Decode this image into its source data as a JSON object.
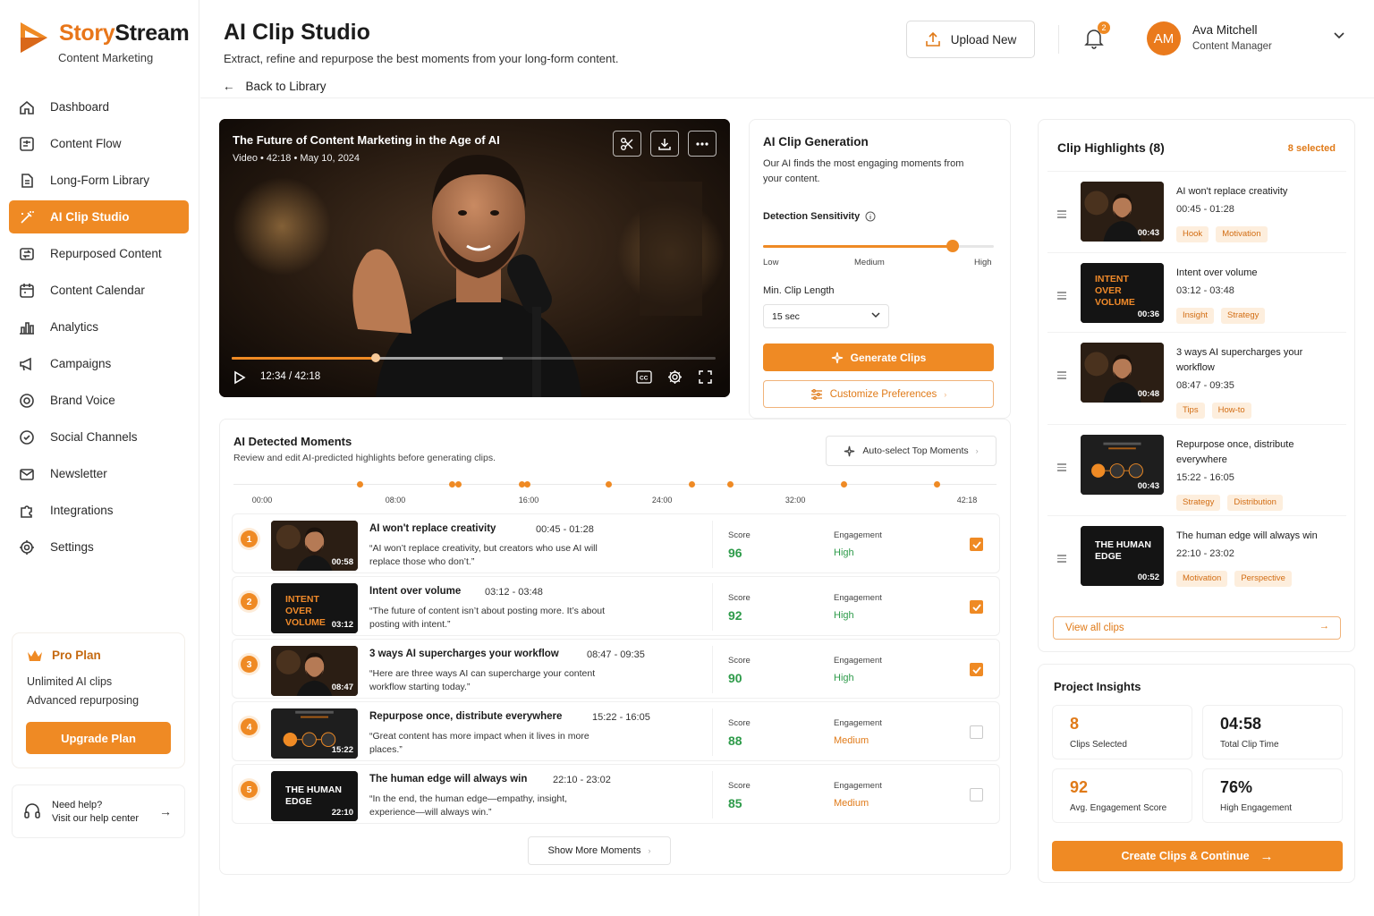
{
  "brand": {
    "name_part1": "Story",
    "name_part2": "Stream",
    "tagline": "Content Marketing"
  },
  "nav": [
    {
      "label": "Dashboard",
      "icon": "home-icon"
    },
    {
      "label": "Content Flow",
      "icon": "flow-icon"
    },
    {
      "label": "Long-Form Library",
      "icon": "document-icon"
    },
    {
      "label": "AI Clip Studio",
      "icon": "wand-icon",
      "active": true
    },
    {
      "label": "Repurposed Content",
      "icon": "repurpose-icon"
    },
    {
      "label": "Content Calendar",
      "icon": "calendar-icon"
    },
    {
      "label": "Analytics",
      "icon": "bar-chart-icon"
    },
    {
      "label": "Campaigns",
      "icon": "megaphone-icon"
    },
    {
      "label": "Brand Voice",
      "icon": "brand-icon"
    },
    {
      "label": "Social Channels",
      "icon": "share-icon"
    },
    {
      "label": "Newsletter",
      "icon": "mail-icon"
    },
    {
      "label": "Integrations",
      "icon": "puzzle-icon"
    },
    {
      "label": "Settings",
      "icon": "gear-icon"
    }
  ],
  "plan": {
    "title": "Pro Plan",
    "feature1": "Unlimited AI clips",
    "feature2": "Advanced repurposing",
    "button": "Upgrade Plan"
  },
  "help": {
    "line1": "Need help?",
    "line2": "Visit our help center"
  },
  "header": {
    "title": "AI Clip Studio",
    "subtitle": "Extract, refine and repurpose the best moments from your long-form content.",
    "back": "Back to Library",
    "upload": "Upload New",
    "notifications": "2",
    "user": {
      "initials": "AM",
      "name": "Ava Mitchell",
      "role": "Content Manager"
    }
  },
  "video": {
    "title": "The Future of Content Marketing in the Age of AI",
    "meta": "Video  •  42:18  •  May 10, 2024",
    "time": "12:34 / 42:18",
    "progress": 0.297,
    "buffered": 0.56
  },
  "generation": {
    "title": "AI Clip Generation",
    "desc": "Our AI finds the most engaging moments from your content.",
    "sensitivity_label": "Detection Sensitivity",
    "sensitivity_value": 0.82,
    "low": "Low",
    "medium": "Medium",
    "high": "High",
    "min_length_label": "Min. Clip Length",
    "min_length_value": "15 sec",
    "generate_btn": "Generate Clips",
    "customize_btn": "Customize Preferences"
  },
  "moments": {
    "title": "AI Detected Moments",
    "subtitle": "Review and edit AI-predicted highlights before generating clips.",
    "auto_btn": "Auto-select Top Moments",
    "ticks": [
      "00:00",
      "08:00",
      "16:00",
      "24:00",
      "32:00",
      "42:18"
    ],
    "markers_min": [
      5.9,
      11.4,
      11.8,
      15.6,
      15.9,
      20.8,
      25.8,
      28.1,
      34.9,
      40.5
    ],
    "score_label": "Score",
    "engagement_label": "Engagement",
    "show_more": "Show More Moments",
    "items": [
      {
        "num": "1",
        "title": "AI won't replace creativity",
        "time": "00:45 - 01:28",
        "quote": "“AI won’t replace creativity, but creators who use AI will replace those who don’t.”",
        "score": "96",
        "engagement": "High",
        "engagement_color": "#2e9b4a",
        "checked": true,
        "thumb_dur": "00:58",
        "thumb_type": "portrait"
      },
      {
        "num": "2",
        "title": "Intent over volume",
        "time": "03:12 - 03:48",
        "quote": "“The future of content isn’t about posting more. It’s about posting with intent.”",
        "score": "92",
        "engagement": "High",
        "engagement_color": "#2e9b4a",
        "checked": true,
        "thumb_dur": "03:12",
        "thumb_type": "text",
        "thumb_text": "INTENT\nOVER\nVOLUME"
      },
      {
        "num": "3",
        "title": "3 ways AI supercharges your workflow",
        "time": "08:47 - 09:35",
        "quote": "“Here are three ways AI can supercharge your content workflow starting today.”",
        "score": "90",
        "engagement": "High",
        "engagement_color": "#2e9b4a",
        "checked": true,
        "thumb_dur": "08:47",
        "thumb_type": "portrait"
      },
      {
        "num": "4",
        "title": "Repurpose once, distribute everywhere",
        "time": "15:22 - 16:05",
        "quote": "“Great content has more impact when it lives in more places.”",
        "score": "88",
        "engagement": "Medium",
        "engagement_color": "#e07a18",
        "checked": false,
        "thumb_dur": "15:22",
        "thumb_type": "icons"
      },
      {
        "num": "5",
        "title": "The human edge will always win",
        "time": "22:10 - 23:02",
        "quote": "“In the end, the human edge—empathy, insight, experience—will always win.”",
        "score": "85",
        "engagement": "Medium",
        "engagement_color": "#e07a18",
        "checked": false,
        "thumb_dur": "22:10",
        "thumb_type": "text-white",
        "thumb_text": "THE HUMAN\nEDGE"
      }
    ]
  },
  "highlights": {
    "title": "Clip Highlights (8)",
    "selected": "8 selected",
    "view_all": "View all clips",
    "items": [
      {
        "title": "AI won't replace creativity",
        "time": "00:45 - 01:28",
        "tags": [
          "Hook",
          "Motivation"
        ],
        "thumb_dur": "00:43",
        "thumb_type": "portrait"
      },
      {
        "title": "Intent over volume",
        "time": "03:12 - 03:48",
        "tags": [
          "Insight",
          "Strategy"
        ],
        "thumb_dur": "00:36",
        "thumb_type": "text",
        "thumb_text": "INTENT\nOVER\nVOLUME"
      },
      {
        "title": "3 ways AI supercharges your workflow",
        "time": "08:47 - 09:35",
        "tags": [
          "Tips",
          "How-to"
        ],
        "thumb_dur": "00:48",
        "thumb_type": "portrait"
      },
      {
        "title": "Repurpose once, distribute everywhere",
        "time": "15:22 - 16:05",
        "tags": [
          "Strategy",
          "Distribution"
        ],
        "thumb_dur": "00:43",
        "thumb_type": "icons"
      },
      {
        "title": "The human edge will always win",
        "time": "22:10 - 23:02",
        "tags": [
          "Motivation",
          "Perspective"
        ],
        "thumb_dur": "00:52",
        "thumb_type": "text-white",
        "thumb_text": "THE HUMAN\nEDGE"
      }
    ]
  },
  "insights": {
    "title": "Project Insights",
    "stats": [
      {
        "value": "8",
        "label": "Clips Selected",
        "color": "#e07a18"
      },
      {
        "value": "04:58",
        "label": "Total Clip Time",
        "color": "#1c1c1c"
      },
      {
        "value": "92",
        "label": "Avg. Engagement Score",
        "color": "#e07a18"
      },
      {
        "value": "76%",
        "label": "High Engagement",
        "color": "#1c1c1c"
      }
    ],
    "cta": "Create Clips & Continue"
  },
  "colors": {
    "accent": "#ef8a24",
    "accent_dark": "#e07a18",
    "success": "#2e9b4a"
  }
}
